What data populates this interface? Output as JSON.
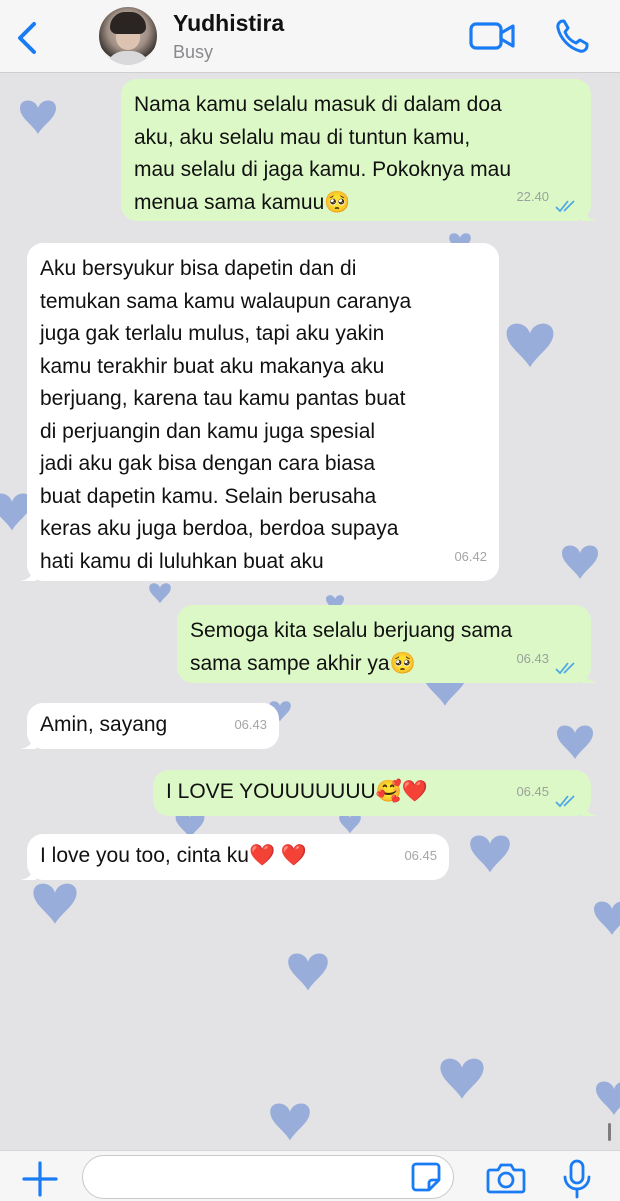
{
  "header": {
    "contact_name": "Yudhistira",
    "status": "Busy"
  },
  "messages": [
    {
      "direction": "outgoing",
      "text": "Nama kamu selalu masuk di dalam doa\naku, aku selalu mau di tuntun kamu,\nmau selalu di jaga kamu. Pokoknya mau\nmenua sama kamuu🥺",
      "time": "22.40",
      "read": true
    },
    {
      "direction": "incoming",
      "text": "Aku bersyukur bisa dapetin dan di\ntemukan sama kamu walaupun caranya\njuga gak terlalu mulus, tapi aku yakin\nkamu terakhir buat aku makanya aku\nberjuang, karena tau kamu pantas buat\ndi perjuangin  dan kamu juga spesial\njadi aku gak bisa dengan cara biasa\nbuat dapetin kamu. Selain berusaha\nkeras aku juga berdoa, berdoa supaya\nhati kamu di luluhkan buat aku",
      "time": "06.42"
    },
    {
      "direction": "outgoing",
      "text": "Semoga kita selalu berjuang sama\nsama sampe akhir ya🥺",
      "time": "06.43",
      "read": true
    },
    {
      "direction": "incoming",
      "text": "Amin, sayang",
      "time": "06.43"
    },
    {
      "direction": "outgoing",
      "text": "I LOVE YOUUUUUUU🥰❤️",
      "time": "06.45",
      "read": true
    },
    {
      "direction": "incoming",
      "text": "I love you too, cinta ku❤️ ❤️",
      "time": "06.45"
    }
  ],
  "input": {
    "value": "",
    "placeholder": ""
  },
  "colors": {
    "accent": "#1a7cf5",
    "outgoing_bubble": "#dcf8c7",
    "incoming_bubble": "#ffffff",
    "read_ticks": "#4fa8e8",
    "wallpaper": "#e3e3e6",
    "wallpaper_hearts": "#6f8fcf"
  },
  "icons": {
    "back": "chevron-left-icon",
    "video": "video-camera-icon",
    "call": "phone-icon",
    "plus": "plus-icon",
    "sticker": "sticker-icon",
    "camera": "camera-icon",
    "mic": "microphone-icon",
    "read": "double-check-icon"
  }
}
